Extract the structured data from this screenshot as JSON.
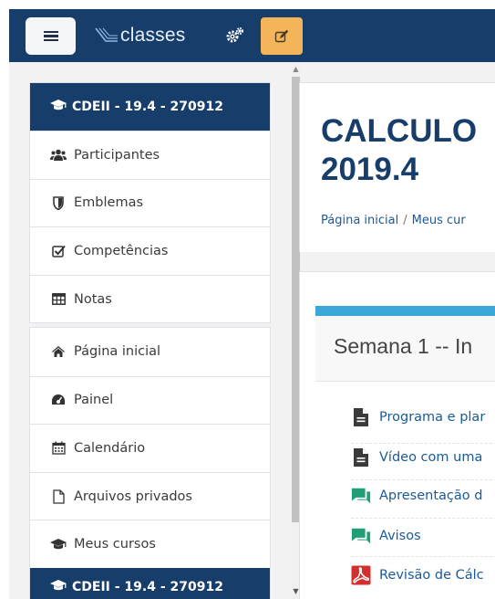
{
  "navbar": {
    "menu_icon": "hamburger-icon",
    "logo_text": "classes",
    "settings_icon": "gears-icon",
    "edit_icon": "edit-pencil-icon",
    "colors": {
      "bar": "#173e6b",
      "edit_button": "#f3b45a"
    }
  },
  "drawer": {
    "course_header": "CDEII - 19.4 - 270912",
    "course_items": [
      {
        "label": "Participantes",
        "icon": "users-icon"
      },
      {
        "label": "Emblemas",
        "icon": "shield-icon"
      },
      {
        "label": "Competências",
        "icon": "checkbox-icon"
      },
      {
        "label": "Notas",
        "icon": "table-icon"
      }
    ],
    "site_items": [
      {
        "label": "Página inicial",
        "icon": "home-icon"
      },
      {
        "label": "Painel",
        "icon": "dashboard-icon"
      },
      {
        "label": "Calendário",
        "icon": "calendar-icon"
      },
      {
        "label": "Arquivos privados",
        "icon": "file-icon"
      },
      {
        "label": "Meus cursos",
        "icon": "graduation-cap-icon"
      }
    ],
    "second_header": "CDEII - 19.4 - 270912"
  },
  "page": {
    "title": "CALCULO\n2019.4",
    "breadcrumb": [
      "Página inicial",
      "Meus cur"
    ]
  },
  "section": {
    "title": "Semana 1 -- In",
    "accent_color": "#3ba6d8",
    "activities": [
      {
        "label": "Programa e plar",
        "icon": "page-icon"
      },
      {
        "label": "Vídeo com uma",
        "icon": "page-icon"
      },
      {
        "label": "Apresentação d",
        "icon": "forum-icon"
      },
      {
        "label": "Avisos",
        "icon": "forum-icon"
      },
      {
        "label": "Revisão de Cálc",
        "icon": "pdf-icon"
      }
    ]
  }
}
